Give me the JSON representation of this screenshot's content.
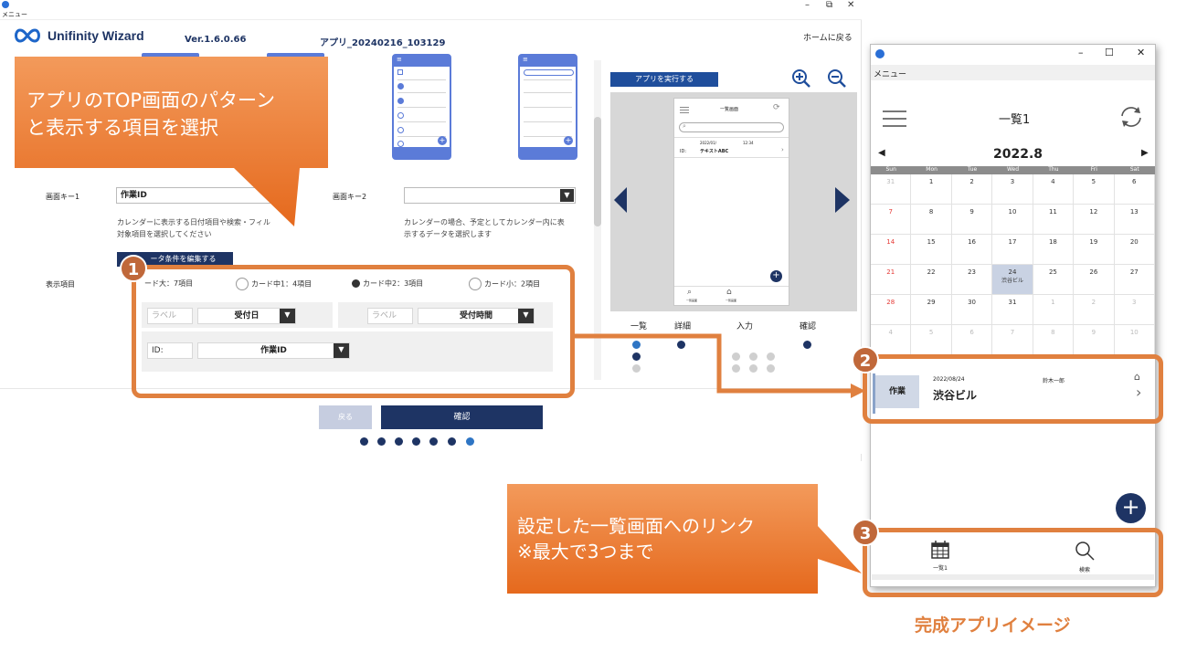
{
  "main_window": {
    "title": "メニュー",
    "controls": {
      "minimize": "–",
      "restore": "⧉",
      "close": "✕"
    }
  },
  "header": {
    "logo_text": "Unifinity Wizard",
    "version": "Ver.1.6.0.66",
    "app_name": "アプリ_20240216_103129",
    "home_link": "ホームに戻る"
  },
  "form": {
    "screen_key1_label": "画面キー1",
    "screen_key1_value": "作業ID",
    "screen_key2_label": "画面キー2",
    "screen_key2_value": "",
    "help_left_line1": "カレンダーに表示する日付項目や検索・フィル",
    "help_left_line2": "対象項目を選択してください",
    "help_right_line1": "カレンダーの場合、予定としてカレンダー内に表",
    "help_right_line2": "示するデータを選択します",
    "edit_button": "ータ条件を編集する",
    "display_items_label": "表示項目",
    "radio_options": [
      "ード大：7項目",
      "カード中1：4項目",
      "カード中2：3項目",
      "カード小：2項目"
    ],
    "card_fields": {
      "label_placeholder_1": "ラベル",
      "field_1": "受付日",
      "label_placeholder_2": "ラベル",
      "field_2": "受付時間",
      "label_3": "ID:",
      "field_3": "作業ID"
    }
  },
  "preview": {
    "run_button": "アプリを実行する",
    "zoom_in_icon": "zoom-in-icon",
    "zoom_out_icon": "zoom-out-icon",
    "phone_title": "一覧画面",
    "phone_date": "2022/01/",
    "phone_time": "12:34",
    "phone_id": "ID:",
    "phone_text": "テキストABC",
    "tabs": [
      "一覧画面",
      "一覧画面"
    ]
  },
  "steps": {
    "labels": [
      "一覧",
      "詳細",
      "入力",
      "確認"
    ]
  },
  "footer": {
    "back_button": "戻る",
    "confirm_button": "確認"
  },
  "callouts": {
    "top": {
      "line1": "アプリのTOP画面のパターン",
      "line2": "と表示する項目を選択"
    },
    "bottom": {
      "line1": "設定した一覧画面へのリンク",
      "line2": "※最大で3つまで"
    },
    "badges": [
      "1",
      "2",
      "3"
    ],
    "caption": "完成アプリイメージ"
  },
  "mobile": {
    "title": "メニュー",
    "controls": {
      "minimize": "–",
      "maximize": "☐",
      "close": "✕"
    },
    "header_title": "一覧1",
    "month": "2022.8",
    "weekdays": [
      "Sun",
      "Mon",
      "Tue",
      "Wed",
      "Thu",
      "Fri",
      "Sat"
    ],
    "weeks": [
      [
        "31",
        "1",
        "2",
        "3",
        "4",
        "5",
        "6"
      ],
      [
        "7",
        "8",
        "9",
        "10",
        "11",
        "12",
        "13"
      ],
      [
        "14",
        "15",
        "16",
        "17",
        "18",
        "19",
        "20"
      ],
      [
        "21",
        "22",
        "23",
        "24",
        "25",
        "26",
        "27"
      ],
      [
        "28",
        "29",
        "30",
        "31",
        "1",
        "2",
        "3"
      ],
      [
        "4",
        "5",
        "6",
        "7",
        "8",
        "9",
        "10"
      ]
    ],
    "event_day_label": "渋谷ビル",
    "card": {
      "tag": "作業",
      "date": "2022/08/24",
      "person": "鈴木一郎",
      "title": "渋谷ビル"
    },
    "bottom_tabs": [
      {
        "label": "一覧1",
        "icon": "calendar-icon"
      },
      {
        "label": "検索",
        "icon": "search-icon"
      }
    ]
  },
  "colors": {
    "navy": "#1e3464",
    "orange": "#e0803f",
    "callout_orange": "#ea7a2c",
    "accent_blue": "#5b7bd8",
    "sunday_red": "#e53935"
  }
}
